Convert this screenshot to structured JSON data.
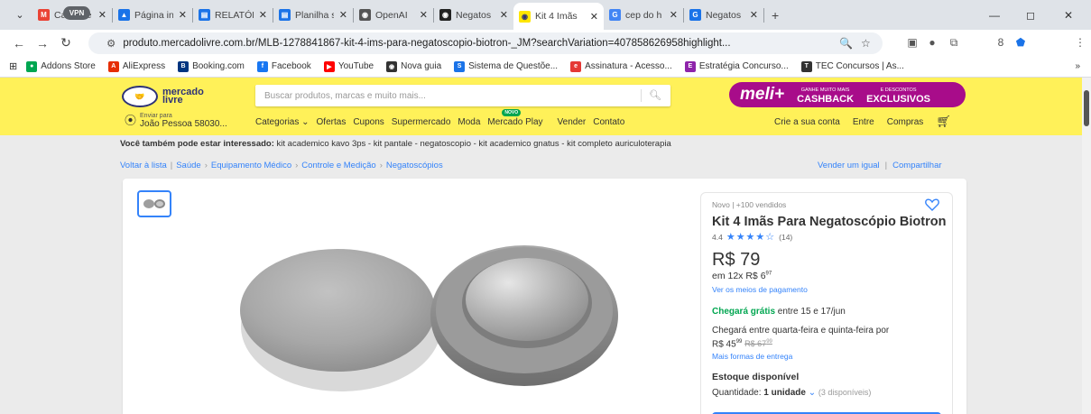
{
  "browser": {
    "tabs": [
      {
        "label": "Caixa de",
        "icon": "gmail-icon",
        "color": "#ea4335",
        "glyph": "M"
      },
      {
        "label": "Página in",
        "icon": "drive-icon",
        "color": "#1a73e8",
        "glyph": "▲"
      },
      {
        "label": "RELATÓRI",
        "icon": "docs-icon",
        "color": "#1a73e8",
        "glyph": "▤"
      },
      {
        "label": "Planilha s",
        "icon": "sheets-icon",
        "color": "#1a73e8",
        "glyph": "▤"
      },
      {
        "label": "OpenAI",
        "icon": "openai-icon",
        "color": "#555555",
        "glyph": "◉"
      },
      {
        "label": "Negatos",
        "icon": "openai-icon",
        "color": "#222222",
        "glyph": "◉"
      },
      {
        "label": "Kit 4 Imãs",
        "icon": "mercadolivre-icon",
        "color": "#ffe600",
        "glyph": "◉",
        "active": true
      },
      {
        "label": "cep do h",
        "icon": "google-icon",
        "color": "#4285f4",
        "glyph": "G"
      },
      {
        "label": "Negatos",
        "icon": "search-icon",
        "color": "#1a73e8",
        "glyph": "G"
      }
    ],
    "new_tab": "+",
    "window_controls": {
      "minimize": "—",
      "restore": "◻",
      "close": "✕"
    },
    "url": "produto.mercadolivre.com.br/MLB-1278841867-kit-4-ims-para-negatoscopio-biotron-_JM?searchVariation=407858626958highlight...",
    "vpn_label": "VPN",
    "bookmarks": [
      {
        "label": "Addons Store",
        "color": "#00a651",
        "glyph": "●"
      },
      {
        "label": "AliExpress",
        "color": "#e62e04",
        "glyph": "A"
      },
      {
        "label": "Booking.com",
        "color": "#003580",
        "glyph": "B"
      },
      {
        "label": "Facebook",
        "color": "#1877f2",
        "glyph": "f"
      },
      {
        "label": "YouTube",
        "color": "#ff0000",
        "glyph": "▶"
      },
      {
        "label": "Nova guia",
        "color": "#333333",
        "glyph": "◉"
      },
      {
        "label": "Sistema de Questõe...",
        "color": "#1a73e8",
        "glyph": "S"
      },
      {
        "label": "Assinatura - Acesso...",
        "color": "#e53935",
        "glyph": "e"
      },
      {
        "label": "Estratégia Concurso...",
        "color": "#8e24aa",
        "glyph": "E"
      },
      {
        "label": "TEC Concursos | As...",
        "color": "#333333",
        "glyph": "T"
      }
    ],
    "bookmarks_more": "»"
  },
  "header": {
    "logo_line1": "mercado",
    "logo_line2": "livre",
    "search_placeholder": "Buscar produtos, marcas e muito mais...",
    "meli_logo": "meli+",
    "meli_b1_small": "GANHE MUITO MAIS",
    "meli_b1_big": "CASHBACK",
    "meli_b2_small": "E DESCONTOS",
    "meli_b2_big": "EXCLUSIVOS",
    "location_small": "Enviar para",
    "location_big": "João Pessoa 58030...",
    "nav": [
      "Categorias ⌄",
      "Ofertas",
      "Cupons",
      "Supermercado",
      "Moda",
      "Mercado Play",
      "Vender",
      "Contato"
    ],
    "novo_badge": "NOVO",
    "account": [
      "Crie a sua conta",
      "Entre",
      "Compras"
    ]
  },
  "page": {
    "also_label": "Você também pode estar interessado:",
    "also_items": "kit academico kavo 3ps - kit pantale - negatoscopio - kit academico gnatus - kit completo auriculoterapia",
    "breadcrumbs": [
      "Voltar à lista",
      "Saúde",
      "Equipamento Médico",
      "Controle e Medição",
      "Negatoscópios"
    ],
    "sell_same": "Vender um igual",
    "share": "Compartilhar"
  },
  "product": {
    "condition": "Novo  |  +100 vendidos",
    "title": "Kit 4 Imãs Para Negatoscópio Biotron",
    "rating": "4.4",
    "stars": "★★★★☆",
    "reviews": "(14)",
    "price": "R$ 79",
    "installments": "em 12x R$ 6",
    "installments_cents": "97",
    "payment_link": "Ver os meios de pagamento",
    "shipping_green": "Chegará grátis",
    "shipping_rest": " entre 15 e 17/jun",
    "ship2_text": "Chegará entre quarta-feira e quinta-feira por",
    "ship2_price": "R$ 45",
    "ship2_price_cents": "99",
    "ship2_old": "R$ 67",
    "ship2_old_cents": "99",
    "more_ways": "Mais formas de entrega",
    "stock": "Estoque disponível",
    "qty_label": "Quantidade: ",
    "qty_value": "1 unidade",
    "qty_avail": "(3 disponíveis)"
  }
}
